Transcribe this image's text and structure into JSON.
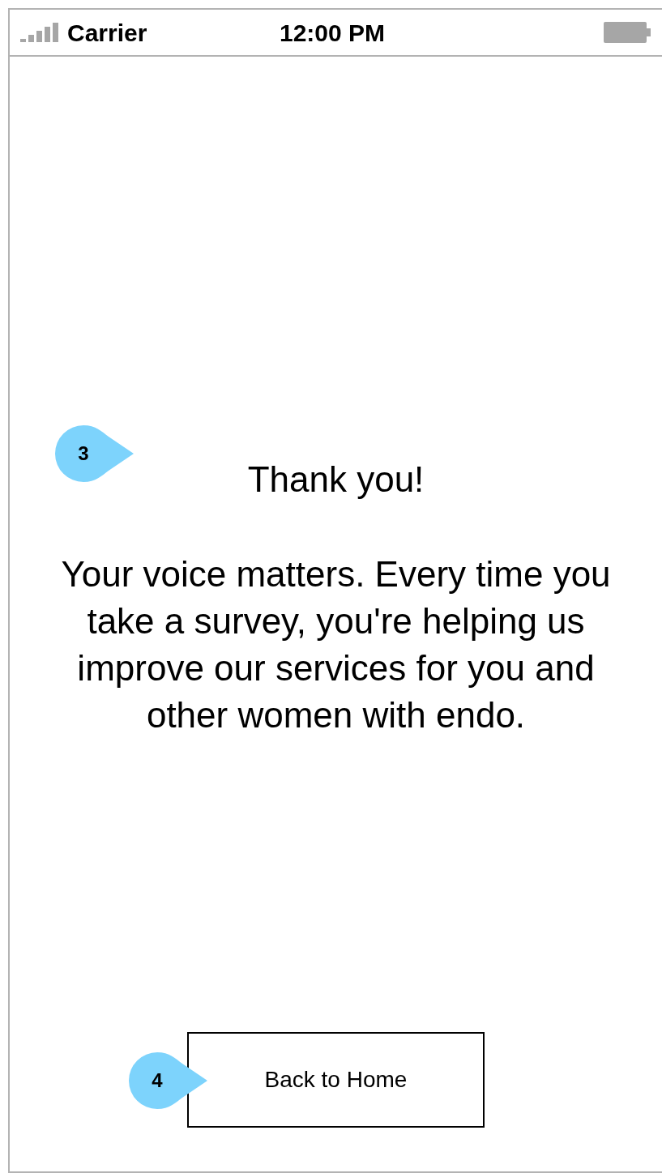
{
  "status_bar": {
    "carrier": "Carrier",
    "time": "12:00 PM"
  },
  "callouts": [
    {
      "number": "3"
    },
    {
      "number": "4"
    }
  ],
  "heading": "Thank you!",
  "message": "Your voice matters. Every time you take a survey, you're helping us improve our services for you and other women with endo.",
  "button": {
    "label": "Back to Home"
  }
}
